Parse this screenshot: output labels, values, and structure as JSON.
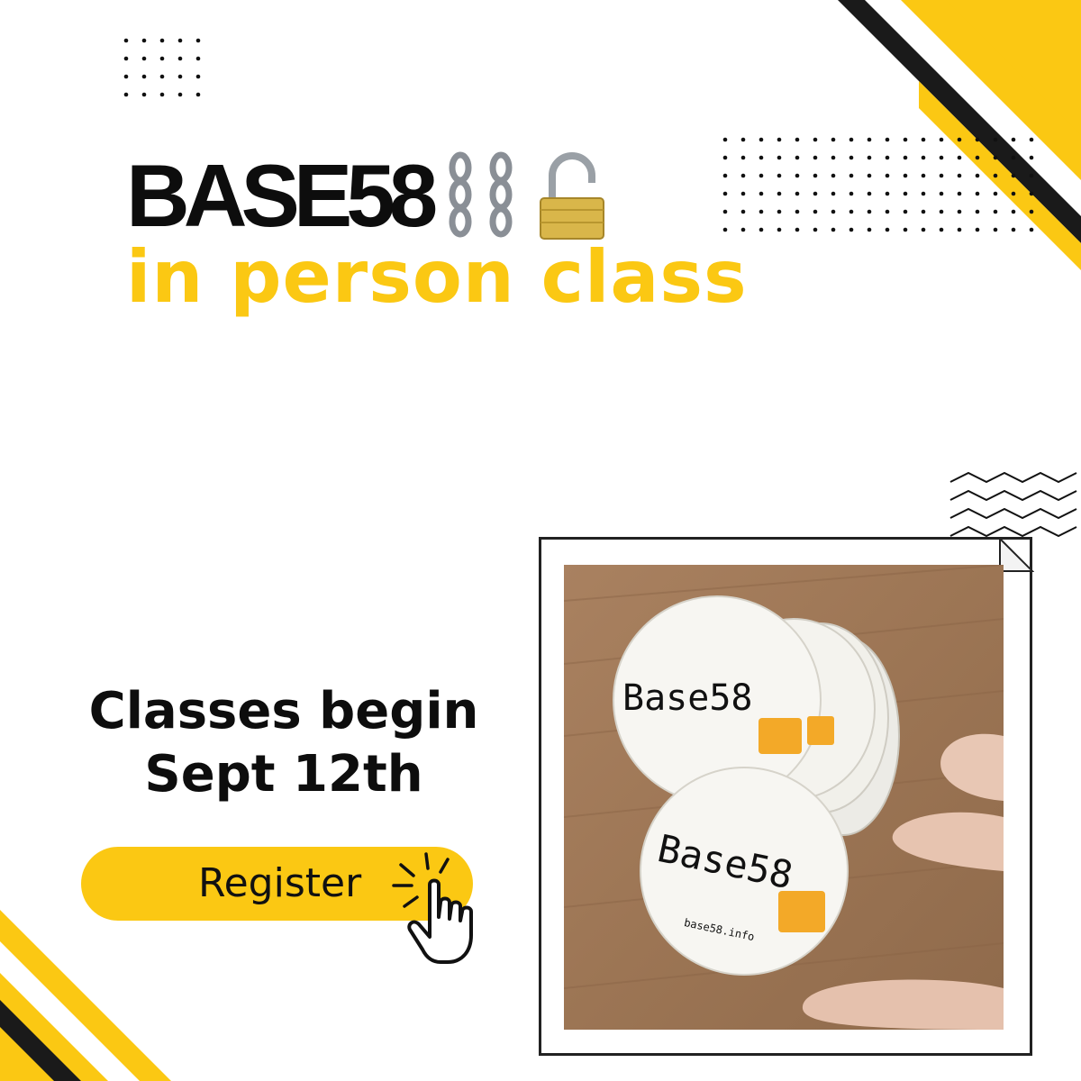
{
  "title": {
    "line1": "BASE58",
    "line1_icons": [
      "chains-icon",
      "chains-icon",
      "open-padlock-icon"
    ],
    "line2": "in person class"
  },
  "info": {
    "line1": "Classes begin",
    "line2": "Sept 12th"
  },
  "cta": {
    "label": "Register",
    "icon": "pointing-hand-click-icon"
  },
  "photo": {
    "sticker_brand": "Base58",
    "sticker_url": "base58.info"
  },
  "colors": {
    "accent": "#fbc813",
    "text": "#0d0d0d",
    "background": "#ffffff"
  }
}
